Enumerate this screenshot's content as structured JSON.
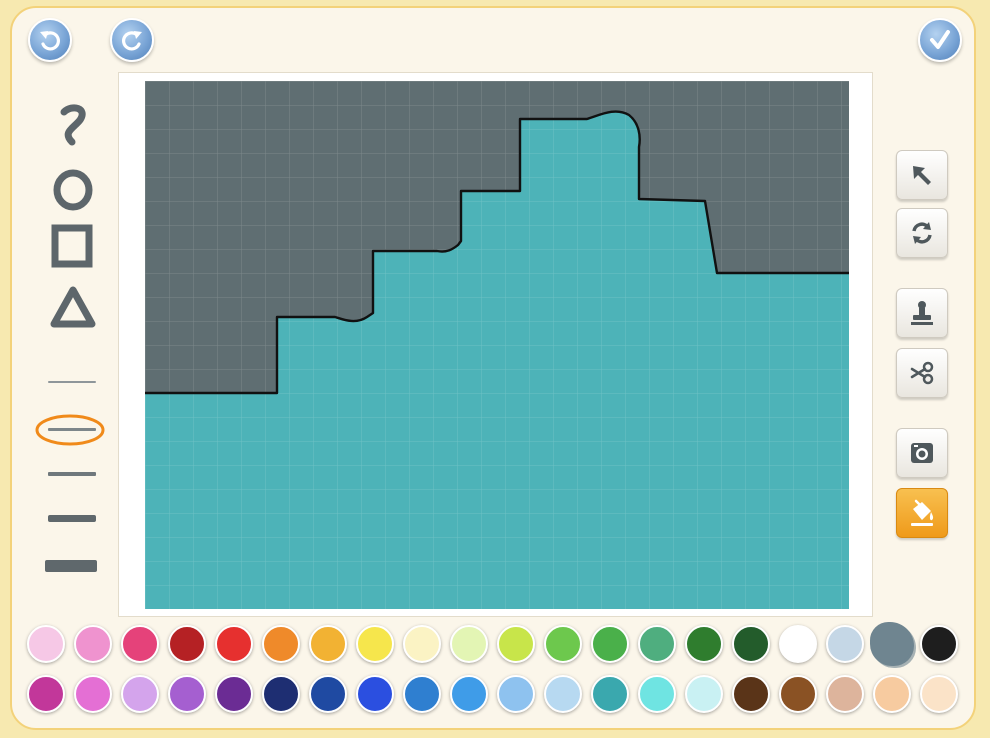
{
  "toolbar_top": {
    "undo_icon": "undo-arrow-icon",
    "redo_icon": "redo-arrow-icon",
    "done_icon": "checkmark-icon"
  },
  "canvas": {
    "background_color": "#5f6e72",
    "fill_color": "#4db3b8",
    "grid": true
  },
  "left_tools": {
    "shapes": [
      "freehand-icon",
      "ellipse-icon",
      "rectangle-icon",
      "triangle-icon"
    ],
    "line_widths": [
      "extra-thin",
      "thin",
      "medium",
      "thick",
      "extra-thick"
    ],
    "selected_line_width": "thin"
  },
  "right_tools": {
    "items": [
      "select-arrow-icon",
      "rotate-icon",
      "stamp-icon",
      "scissors-icon",
      "camera-icon",
      "paint-bucket-icon"
    ],
    "active": "paint-bucket-icon"
  },
  "palette": {
    "row1": [
      "#f6c8e6",
      "#ef93cf",
      "#e5427a",
      "#b52124",
      "#e6302f",
      "#ef8a2a",
      "#f2b233",
      "#f6e64c",
      "#fbf3c4",
      "#e3f5b4",
      "#c8e54a",
      "#6dc84d",
      "#4ab04a",
      "#4fae7f",
      "#2f7d2e",
      "#235c2b",
      "#ffffff",
      "#c5d7e6",
      "#6f8590",
      "#1e1e1e"
    ],
    "row2": [
      "#c2379a",
      "#e46fd4",
      "#d4a4ec",
      "#a55fd0",
      "#6b2c94",
      "#1e2e72",
      "#1f4aa2",
      "#2b4fe0",
      "#2f7fd0",
      "#3f9ce8",
      "#8ec2ef",
      "#b7d9f1",
      "#3aa8ae",
      "#6fe4e2",
      "#c9f1f3",
      "#5a3418",
      "#8a5224",
      "#ddb49c",
      "#f7cba0",
      "#fbe3c8"
    ],
    "selected": "#6f8590"
  }
}
